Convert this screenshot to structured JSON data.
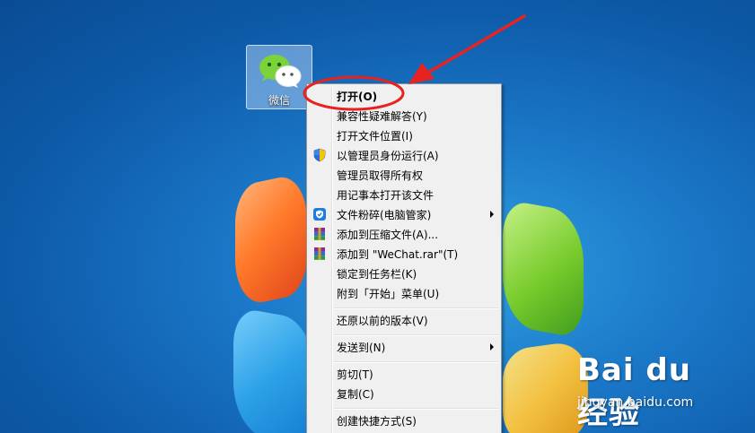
{
  "desktop": {
    "icon_label": "微信"
  },
  "context_menu": {
    "items": [
      {
        "label": "打开(O)",
        "bold": true,
        "icon": ""
      },
      {
        "label": "兼容性疑难解答(Y)",
        "icon": ""
      },
      {
        "label": "打开文件位置(I)",
        "icon": ""
      },
      {
        "label": "以管理员身份运行(A)",
        "icon": "uac-shield-icon"
      },
      {
        "label": "管理员取得所有权",
        "icon": ""
      },
      {
        "label": "用记事本打开该文件",
        "icon": ""
      },
      {
        "label": "文件粉碎(电脑管家)",
        "icon": "pc-manager-shield-icon",
        "submenu": true
      },
      {
        "label": "添加到压缩文件(A)...",
        "icon": "winrar-icon"
      },
      {
        "label": "添加到 \"WeChat.rar\"(T)",
        "icon": "winrar-icon"
      },
      {
        "label": "锁定到任务栏(K)",
        "icon": ""
      },
      {
        "label": "附到「开始」菜单(U)",
        "icon": ""
      },
      {
        "label": "还原以前的版本(V)",
        "icon": ""
      },
      {
        "label": "发送到(N)",
        "icon": "",
        "submenu": true
      },
      {
        "label": "剪切(T)",
        "icon": ""
      },
      {
        "label": "复制(C)",
        "icon": ""
      },
      {
        "label": "创建快捷方式(S)",
        "icon": ""
      }
    ]
  },
  "watermark": {
    "logo_text": "Bai du 经验",
    "url": "jingyan.baidu.com"
  },
  "colors": {
    "annotation": "#e8231f",
    "menu_bg": "#f0f0f0"
  }
}
